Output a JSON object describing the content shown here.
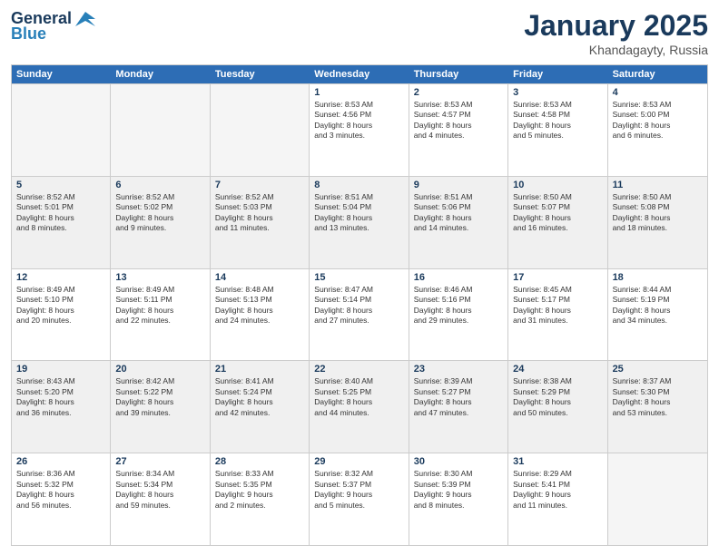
{
  "header": {
    "logo_line1": "General",
    "logo_line2": "Blue",
    "month": "January 2025",
    "location": "Khandagayty, Russia"
  },
  "weekdays": [
    "Sunday",
    "Monday",
    "Tuesday",
    "Wednesday",
    "Thursday",
    "Friday",
    "Saturday"
  ],
  "rows": [
    [
      {
        "day": "",
        "info": "",
        "empty": true
      },
      {
        "day": "",
        "info": "",
        "empty": true
      },
      {
        "day": "",
        "info": "",
        "empty": true
      },
      {
        "day": "1",
        "info": "Sunrise: 8:53 AM\nSunset: 4:56 PM\nDaylight: 8 hours\nand 3 minutes."
      },
      {
        "day": "2",
        "info": "Sunrise: 8:53 AM\nSunset: 4:57 PM\nDaylight: 8 hours\nand 4 minutes."
      },
      {
        "day": "3",
        "info": "Sunrise: 8:53 AM\nSunset: 4:58 PM\nDaylight: 8 hours\nand 5 minutes."
      },
      {
        "day": "4",
        "info": "Sunrise: 8:53 AM\nSunset: 5:00 PM\nDaylight: 8 hours\nand 6 minutes."
      }
    ],
    [
      {
        "day": "5",
        "info": "Sunrise: 8:52 AM\nSunset: 5:01 PM\nDaylight: 8 hours\nand 8 minutes.",
        "shaded": true
      },
      {
        "day": "6",
        "info": "Sunrise: 8:52 AM\nSunset: 5:02 PM\nDaylight: 8 hours\nand 9 minutes.",
        "shaded": true
      },
      {
        "day": "7",
        "info": "Sunrise: 8:52 AM\nSunset: 5:03 PM\nDaylight: 8 hours\nand 11 minutes.",
        "shaded": true
      },
      {
        "day": "8",
        "info": "Sunrise: 8:51 AM\nSunset: 5:04 PM\nDaylight: 8 hours\nand 13 minutes.",
        "shaded": true
      },
      {
        "day": "9",
        "info": "Sunrise: 8:51 AM\nSunset: 5:06 PM\nDaylight: 8 hours\nand 14 minutes.",
        "shaded": true
      },
      {
        "day": "10",
        "info": "Sunrise: 8:50 AM\nSunset: 5:07 PM\nDaylight: 8 hours\nand 16 minutes.",
        "shaded": true
      },
      {
        "day": "11",
        "info": "Sunrise: 8:50 AM\nSunset: 5:08 PM\nDaylight: 8 hours\nand 18 minutes.",
        "shaded": true
      }
    ],
    [
      {
        "day": "12",
        "info": "Sunrise: 8:49 AM\nSunset: 5:10 PM\nDaylight: 8 hours\nand 20 minutes."
      },
      {
        "day": "13",
        "info": "Sunrise: 8:49 AM\nSunset: 5:11 PM\nDaylight: 8 hours\nand 22 minutes."
      },
      {
        "day": "14",
        "info": "Sunrise: 8:48 AM\nSunset: 5:13 PM\nDaylight: 8 hours\nand 24 minutes."
      },
      {
        "day": "15",
        "info": "Sunrise: 8:47 AM\nSunset: 5:14 PM\nDaylight: 8 hours\nand 27 minutes."
      },
      {
        "day": "16",
        "info": "Sunrise: 8:46 AM\nSunset: 5:16 PM\nDaylight: 8 hours\nand 29 minutes."
      },
      {
        "day": "17",
        "info": "Sunrise: 8:45 AM\nSunset: 5:17 PM\nDaylight: 8 hours\nand 31 minutes."
      },
      {
        "day": "18",
        "info": "Sunrise: 8:44 AM\nSunset: 5:19 PM\nDaylight: 8 hours\nand 34 minutes."
      }
    ],
    [
      {
        "day": "19",
        "info": "Sunrise: 8:43 AM\nSunset: 5:20 PM\nDaylight: 8 hours\nand 36 minutes.",
        "shaded": true
      },
      {
        "day": "20",
        "info": "Sunrise: 8:42 AM\nSunset: 5:22 PM\nDaylight: 8 hours\nand 39 minutes.",
        "shaded": true
      },
      {
        "day": "21",
        "info": "Sunrise: 8:41 AM\nSunset: 5:24 PM\nDaylight: 8 hours\nand 42 minutes.",
        "shaded": true
      },
      {
        "day": "22",
        "info": "Sunrise: 8:40 AM\nSunset: 5:25 PM\nDaylight: 8 hours\nand 44 minutes.",
        "shaded": true
      },
      {
        "day": "23",
        "info": "Sunrise: 8:39 AM\nSunset: 5:27 PM\nDaylight: 8 hours\nand 47 minutes.",
        "shaded": true
      },
      {
        "day": "24",
        "info": "Sunrise: 8:38 AM\nSunset: 5:29 PM\nDaylight: 8 hours\nand 50 minutes.",
        "shaded": true
      },
      {
        "day": "25",
        "info": "Sunrise: 8:37 AM\nSunset: 5:30 PM\nDaylight: 8 hours\nand 53 minutes.",
        "shaded": true
      }
    ],
    [
      {
        "day": "26",
        "info": "Sunrise: 8:36 AM\nSunset: 5:32 PM\nDaylight: 8 hours\nand 56 minutes."
      },
      {
        "day": "27",
        "info": "Sunrise: 8:34 AM\nSunset: 5:34 PM\nDaylight: 8 hours\nand 59 minutes."
      },
      {
        "day": "28",
        "info": "Sunrise: 8:33 AM\nSunset: 5:35 PM\nDaylight: 9 hours\nand 2 minutes."
      },
      {
        "day": "29",
        "info": "Sunrise: 8:32 AM\nSunset: 5:37 PM\nDaylight: 9 hours\nand 5 minutes."
      },
      {
        "day": "30",
        "info": "Sunrise: 8:30 AM\nSunset: 5:39 PM\nDaylight: 9 hours\nand 8 minutes."
      },
      {
        "day": "31",
        "info": "Sunrise: 8:29 AM\nSunset: 5:41 PM\nDaylight: 9 hours\nand 11 minutes."
      },
      {
        "day": "",
        "info": "",
        "empty": true
      }
    ]
  ]
}
